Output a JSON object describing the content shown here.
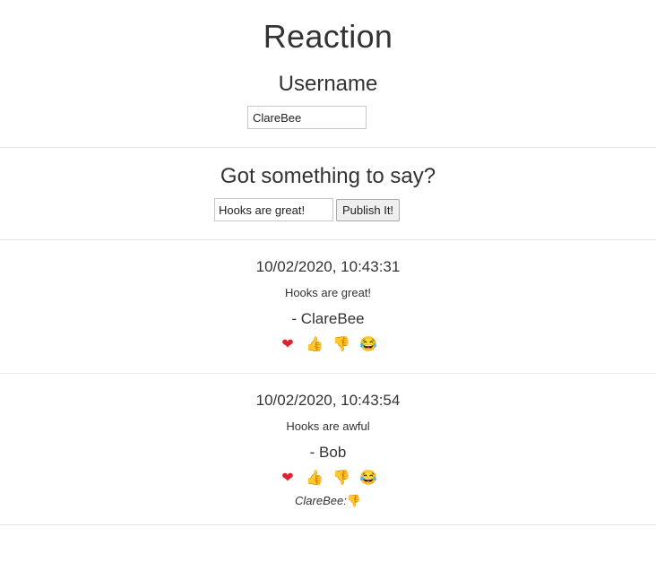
{
  "header": {
    "title": "Reaction",
    "username_heading": "Username"
  },
  "username_input": {
    "value": "ClareBee"
  },
  "compose": {
    "heading": "Got something to say?",
    "input_value": "Hooks are great!",
    "publish_label": "Publish It!"
  },
  "reaction_icons": {
    "heart": "❤",
    "thumbs_up": "👍",
    "thumbs_down": "👎",
    "laugh": "😂"
  },
  "posts": [
    {
      "timestamp": "10/02/2020, 10:43:31",
      "text": "Hooks are great!",
      "author": "- ClareBee",
      "reactions_log": []
    },
    {
      "timestamp": "10/02/2020, 10:43:54",
      "text": "Hooks are awful",
      "author": "- Bob",
      "reactions_log": [
        {
          "user": "ClareBee:",
          "emoji": "👎"
        }
      ]
    }
  ]
}
